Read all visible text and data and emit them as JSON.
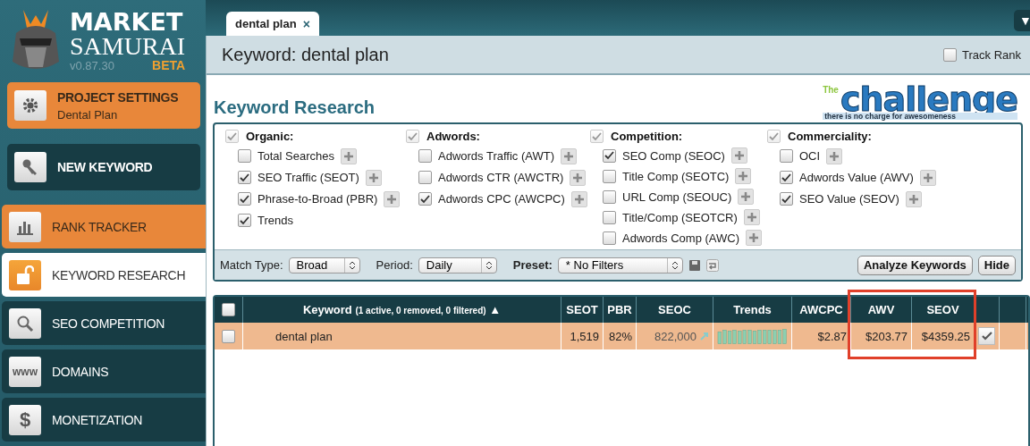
{
  "logo": {
    "line1": "MARKET",
    "line2": "SAMURAI",
    "version": "v0.87.30",
    "badge": "BETA"
  },
  "sidebar": {
    "items": [
      {
        "label": "PROJECT SETTINGS",
        "sublabel": "Dental Plan",
        "kind": "card",
        "color": "#e8873a",
        "selected": false
      },
      {
        "label": "NEW KEYWORD",
        "kind": "card",
        "color": "#173c44",
        "selected": false
      },
      {
        "label": "RANK TRACKER",
        "kind": "tab",
        "color": "#e8873a",
        "selected": false
      },
      {
        "label": "KEYWORD RESEARCH",
        "kind": "tab",
        "color": "#ffffff",
        "selected": true
      },
      {
        "label": "SEO COMPETITION",
        "kind": "tab",
        "color": "#173c44",
        "selected": false
      },
      {
        "label": "DOMAINS",
        "icon_text": "www",
        "kind": "tab",
        "color": "#173c44",
        "selected": false
      },
      {
        "label": "MONETIZATION",
        "icon_text": "$",
        "kind": "tab",
        "color": "#173c44",
        "selected": false
      }
    ]
  },
  "tabs": [
    {
      "label": "dental plan",
      "close": "×",
      "selected": true
    }
  ],
  "menu_button": "▼",
  "header": {
    "title": "Keyword: dental plan",
    "track_rank": {
      "label": "Track Rank",
      "checked": false
    }
  },
  "section_title": "Keyword Research",
  "banner": {
    "small": "The",
    "big": "challenge",
    "tagline": "there is no charge for awesomeness"
  },
  "filter_groups": [
    {
      "title": "Organic:",
      "checked": true,
      "disabled": true,
      "options": [
        {
          "label": "Total Searches",
          "checked": false
        },
        {
          "label": "SEO Traffic (SEOT)",
          "checked": true
        },
        {
          "label": "Phrase-to-Broad (PBR)",
          "checked": true
        },
        {
          "label": "Trends",
          "checked": true,
          "addable": false
        }
      ]
    },
    {
      "title": "Adwords:",
      "checked": true,
      "disabled": true,
      "options": [
        {
          "label": "Adwords Traffic (AWT)",
          "checked": false
        },
        {
          "label": "Adwords CTR (AWCTR)",
          "checked": false
        },
        {
          "label": "Adwords CPC (AWCPC)",
          "checked": true
        }
      ]
    },
    {
      "title": "Competition:",
      "checked": true,
      "disabled": true,
      "options": [
        {
          "label": "SEO Comp (SEOC)",
          "checked": true
        },
        {
          "label": "Title Comp (SEOTC)",
          "checked": false
        },
        {
          "label": "URL Comp (SEOUC)",
          "checked": false
        },
        {
          "label": "Title/Comp (SEOTCR)",
          "checked": false
        },
        {
          "label": "Adwords Comp (AWC)",
          "checked": false
        }
      ]
    },
    {
      "title": "Commerciality:",
      "checked": true,
      "disabled": true,
      "options": [
        {
          "label": "OCI",
          "checked": false
        },
        {
          "label": "Adwords Value (AWV)",
          "checked": true
        },
        {
          "label": "SEO Value (SEOV)",
          "checked": true
        }
      ]
    }
  ],
  "options_bar": {
    "selects": [
      {
        "label": "Match Type:",
        "value": "Broad",
        "bold": false
      },
      {
        "label": "Period:",
        "value": "Daily",
        "bold": false
      },
      {
        "label": "Preset:",
        "value": "* No Filters",
        "bold": true
      }
    ],
    "buttons": [
      "Analyze Keywords",
      "Hide"
    ]
  },
  "table": {
    "select_all": false,
    "columns": [
      {
        "kind": "check",
        "highlighted": false
      },
      {
        "kind": "keyword",
        "label": "Keyword",
        "note": "(1 active, 0 removed, 0 filtered)",
        "sort": "▲",
        "highlighted": false
      },
      {
        "kind": "text",
        "label": "SEOT",
        "highlighted": false
      },
      {
        "kind": "text",
        "label": "PBR",
        "highlighted": false
      },
      {
        "kind": "text",
        "label": "SEOC",
        "highlighted": false
      },
      {
        "kind": "text",
        "label": "Trends",
        "highlighted": false
      },
      {
        "kind": "text",
        "label": "AWCPC",
        "highlighted": false
      },
      {
        "kind": "text",
        "label": "AWV",
        "highlighted": true
      },
      {
        "kind": "text",
        "label": "SEOV",
        "highlighted": true
      },
      {
        "kind": "blank",
        "highlighted": false
      },
      {
        "kind": "blank",
        "highlighted": false
      }
    ],
    "rows": [
      {
        "checked": false,
        "keyword": "dental plan",
        "seot": "1,519",
        "pbr": "82%",
        "seoc": "822,000",
        "awcpc": "$2.87",
        "awv": "$203.77",
        "seov": "$4359.25",
        "ticked": true
      }
    ]
  }
}
